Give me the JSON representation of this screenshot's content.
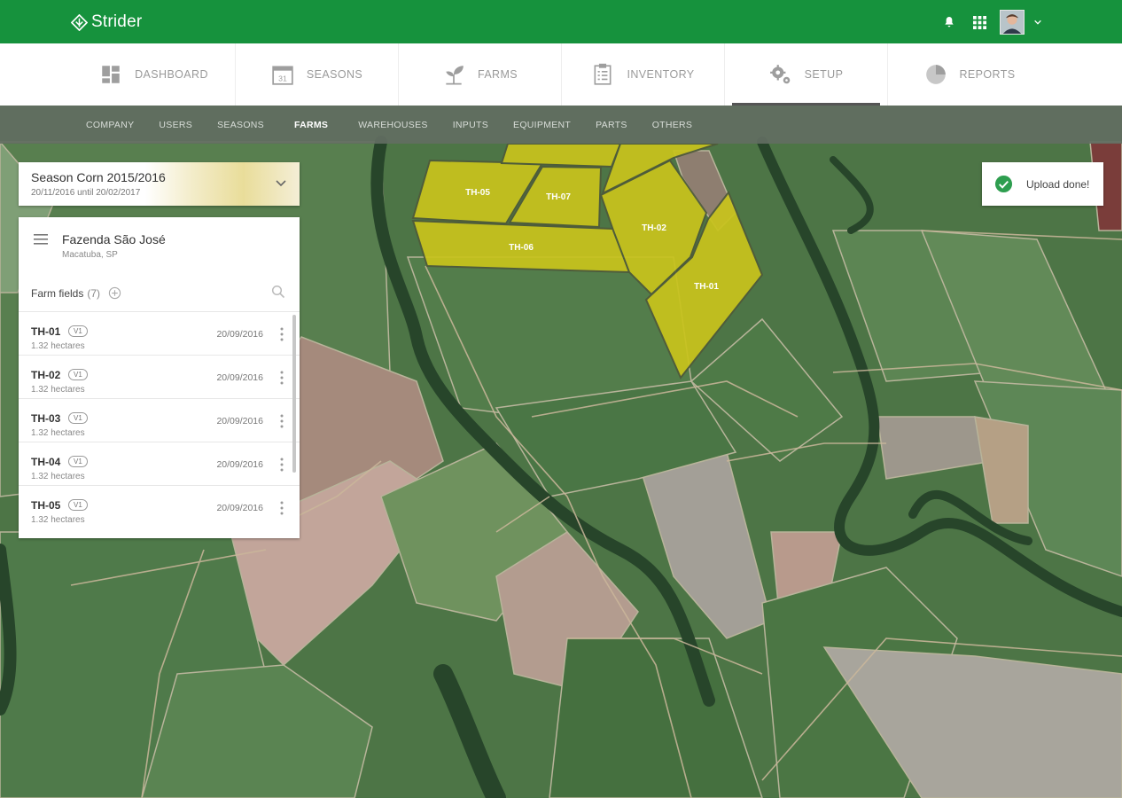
{
  "app": {
    "brand": "Strider"
  },
  "header": {
    "icons": [
      "bell-icon",
      "apps-grid-icon",
      "avatar",
      "chevron-down-icon"
    ]
  },
  "main_nav": {
    "items": [
      {
        "label": "DASHBOARD",
        "icon": "dashboard-icon"
      },
      {
        "label": "SEASONS",
        "icon": "calendar-icon",
        "icon_text": "31"
      },
      {
        "label": "FARMS",
        "icon": "sprout-icon"
      },
      {
        "label": "INVENTORY",
        "icon": "clipboard-icon"
      },
      {
        "label": "SETUP",
        "icon": "gears-icon",
        "active": true
      },
      {
        "label": "REPORTS",
        "icon": "pie-chart-icon"
      }
    ]
  },
  "sub_nav": {
    "items": [
      {
        "label": "COMPANY"
      },
      {
        "label": "USERS"
      },
      {
        "label": "SEASONS"
      },
      {
        "label": "FARMS",
        "active": true
      },
      {
        "label": "WAREHOUSES"
      },
      {
        "label": "INPUTS"
      },
      {
        "label": "EQUIPMENT"
      },
      {
        "label": "PARTS"
      },
      {
        "label": "OTHERS"
      }
    ]
  },
  "season": {
    "title": "Season Corn 2015/2016",
    "dates": "20/11/2016 until 20/02/2017"
  },
  "farm": {
    "name": "Fazenda São José",
    "location": "Macatuba, SP",
    "fields_label": "Farm fields",
    "fields_count": "(7)",
    "fields": [
      {
        "name": "TH-01",
        "badge": "V1",
        "area": "1.32 hectares",
        "date": "20/09/2016"
      },
      {
        "name": "TH-02",
        "badge": "V1",
        "area": "1.32 hectares",
        "date": "20/09/2016"
      },
      {
        "name": "TH-03",
        "badge": "V1",
        "area": "1.32 hectares",
        "date": "20/09/2016"
      },
      {
        "name": "TH-04",
        "badge": "V1",
        "area": "1.32 hectares",
        "date": "20/09/2016"
      },
      {
        "name": "TH-05",
        "badge": "V1",
        "area": "1.32 hectares",
        "date": "20/09/2016"
      }
    ]
  },
  "map": {
    "field_labels": {
      "th01": "TH-01",
      "th02": "TH-02",
      "th05": "TH-05",
      "th06": "TH-06",
      "th07": "TH-07"
    },
    "field_color": "#c9c41c"
  },
  "toast": {
    "text": "Upload done!",
    "icon": "check-circle-icon",
    "color": "#2e9e4f"
  },
  "colors": {
    "brand_green": "#16923d"
  }
}
